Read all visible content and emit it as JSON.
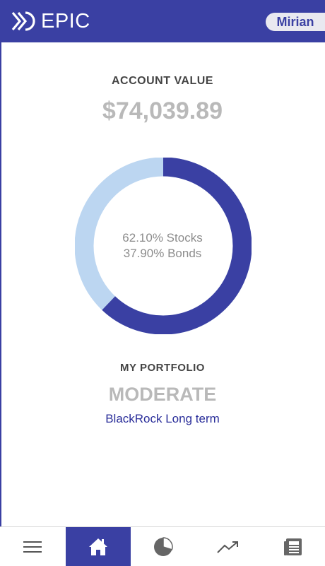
{
  "header": {
    "logo_text": "EPIC",
    "user_name": "Mirian"
  },
  "account": {
    "label": "ACCOUNT VALUE",
    "value": "$74,039.89"
  },
  "allocation": {
    "stocks_label": "62.10% Stocks",
    "bonds_label": "37.90% Bonds",
    "stocks_fraction": 0.621,
    "bonds_fraction": 0.379,
    "stocks_color": "#3a40a3",
    "bonds_color": "#bcd6f1"
  },
  "portfolio": {
    "label": "MY PORTFOLIO",
    "risk_level": "MODERATE",
    "fund_link": "BlackRock Long term"
  },
  "bottom_nav": {
    "items": [
      {
        "icon": "menu-icon",
        "active": false
      },
      {
        "icon": "home-icon",
        "active": true
      },
      {
        "icon": "pie-chart-icon",
        "active": false
      },
      {
        "icon": "trend-icon",
        "active": false
      },
      {
        "icon": "document-icon",
        "active": false
      }
    ]
  },
  "colors": {
    "brand": "#3a40a3",
    "muted_text": "#b9b9b9",
    "link": "#2a2e9a"
  }
}
